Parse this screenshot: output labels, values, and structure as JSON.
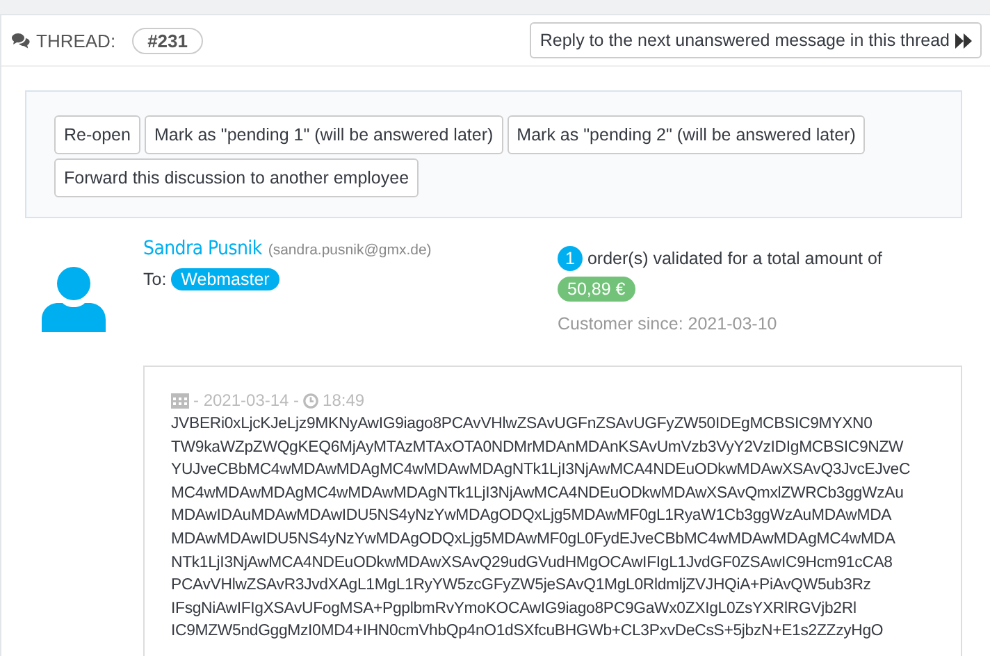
{
  "thread": {
    "label": "THREAD:",
    "number": "#231",
    "next_button": "Reply to the next unanswered message in this thread"
  },
  "actions": [
    "Re-open",
    "Mark as \"pending 1\" (will be answered later)",
    "Mark as \"pending 2\" (will be answered later)",
    "Forward this discussion to another employee"
  ],
  "customer": {
    "name": "Sandra Pusnik",
    "email": "(sandra.pusnik@gmx.de)",
    "to_label": "To:",
    "to": "Webmaster",
    "orders_count": "1",
    "orders_text": "order(s) validated for a total amount of",
    "amount": "50,89 €",
    "since": "Customer since: 2021-03-10"
  },
  "message": {
    "date": "- 2021-03-14 -",
    "time": "18:49",
    "lines": [
      "JVBERi0xLjcKJeLjz9MKNyAwIG9iago8PCAvVHlwZSAvUGFnZSAvUGFyZW50IDEgMCBSIC9MYXN0",
      "TW9kaWZpZWQgKEQ6MjAyMTAzMTAxOTA0NDMrMDAnMDAnKSAvUmVzb3VyY2VzIDIgMCBSIC9NZW",
      "YUJveCBbMC4wMDAwMDAgMC4wMDAwMDAgNTk1LjI3NjAwMCA4NDEuODkwMDAwXSAvQ3JvcEJveC",
      "MC4wMDAwMDAgMC4wMDAwMDAgNTk1LjI3NjAwMCA4NDEuODkwMDAwXSAvQmxlZWRCb3ggWzAu",
      "MDAwIDAuMDAwMDAwIDU5NS4yNzYwMDAgODQxLjg5MDAwMF0gL1RyaW1Cb3ggWzAuMDAwMDA",
      "MDAwMDAwIDU5NS4yNzYwMDAgODQxLjg5MDAwMF0gL0FydEJveCBbMC4wMDAwMDAgMC4wMDA",
      "NTk1LjI3NjAwMCA4NDEuODkwMDAwXSAvQ29udGVudHMgOCAwIFIgL1JvdGF0ZSAwIC9Hcm91cCA8",
      "PCAvVHlwZSAvR3JvdXAgL1MgL1RyYW5zcGFyZW5jeSAvQ1MgL0RldmljZVJHQiA+PiAvQW5ub3Rz",
      "IFsgNiAwIFIgXSAvUFogMSA+PgplbmRvYmoKOCAwIG9iago8PC9GaWx0ZXIgL0ZsYXRlRGVjb2Rl",
      "IC9MZW5ndGggMzI0MD4+IHN0cmVhbQp4nO1dSXfcuBHGWb+CL3PxvDeCsS+5jbzN+E1s2ZZzyHgO"
    ]
  }
}
